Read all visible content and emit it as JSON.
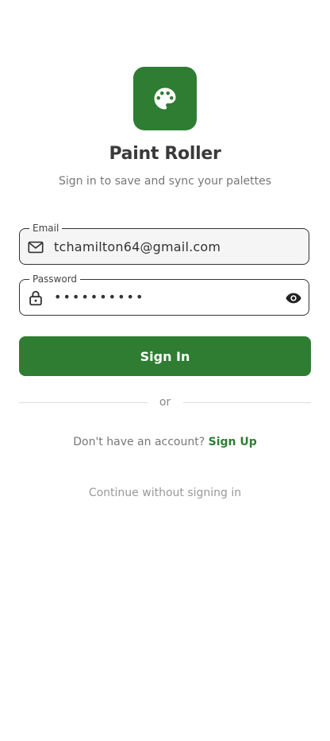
{
  "app": {
    "title": "Paint Roller",
    "subtitle": "Sign in to save and sync your palettes",
    "logo_icon": "palette-icon",
    "accent_color": "#2e7d32"
  },
  "form": {
    "email": {
      "label": "Email",
      "value": "tchamilton64@gmail.com",
      "icon": "mail-icon"
    },
    "password": {
      "label": "Password",
      "value": "••••••••••",
      "icon": "lock-icon",
      "toggle_icon": "eye-icon"
    },
    "submit_label": "Sign In"
  },
  "divider": {
    "label": "or"
  },
  "signup": {
    "prompt": "Don't have an account?",
    "link_label": "Sign Up"
  },
  "guest": {
    "label": "Continue without signing in"
  }
}
